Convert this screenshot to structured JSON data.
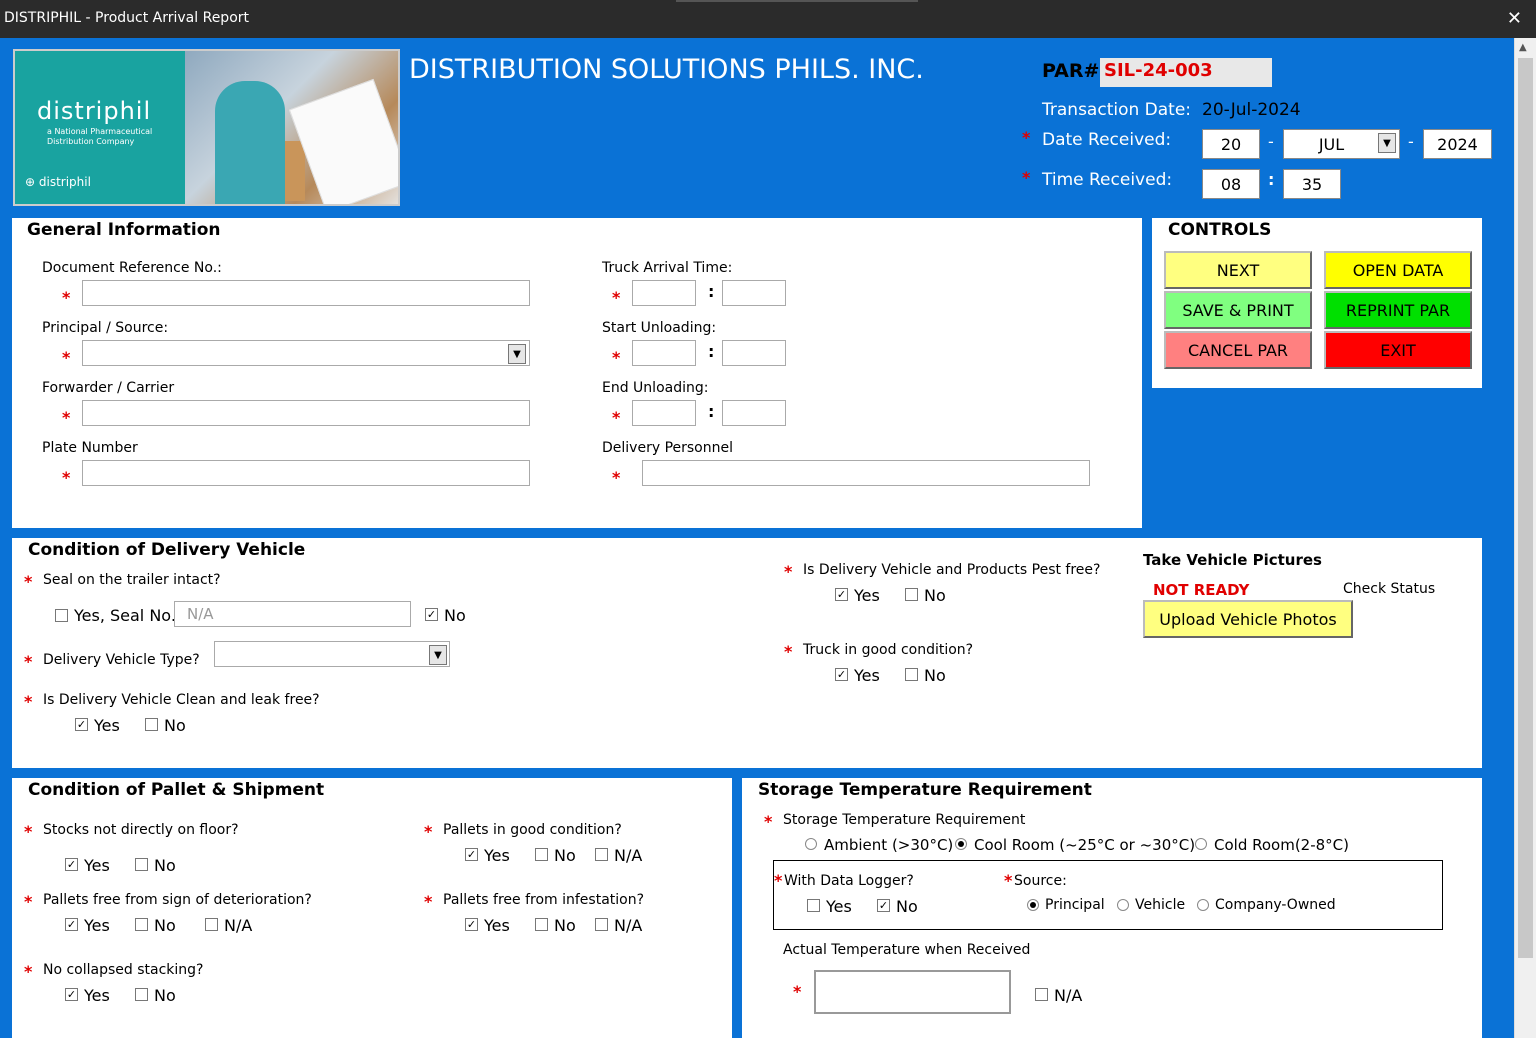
{
  "window": {
    "title": "DISTRIPHIL - Product Arrival Report",
    "close": "✕"
  },
  "logo": {
    "brand": "distriphil",
    "tagline": "a National Pharmaceutical Distribution Company",
    "mini": "distriphil"
  },
  "header": {
    "company": "DISTRIBUTION SOLUTIONS PHILS. INC.",
    "par_label": "PAR#",
    "par_value": "SIL-24-003",
    "transaction_date_label": "Transaction Date:",
    "transaction_date": "20-Jul-2024",
    "date_received_label": "Date Received:",
    "date_day": "20",
    "date_month": "JUL",
    "date_year": "2024",
    "time_received_label": "Time Received:",
    "time_hour": "08",
    "time_min": "35",
    "dash": "-",
    "colon": ":",
    "req": "*"
  },
  "general": {
    "title": "General Information",
    "doc_ref": "Document Reference No.:",
    "principal": "Principal / Source:",
    "forwarder": "Forwarder / Carrier",
    "plate": "Plate Number",
    "truck_arrival": "Truck Arrival Time:",
    "start_unloading": "Start Unloading:",
    "end_unloading": "End Unloading:",
    "personnel": "Delivery Personnel"
  },
  "controls": {
    "title": "CONTROLS",
    "next": "NEXT",
    "open_data": "OPEN DATA",
    "save_print": "SAVE & PRINT",
    "reprint": "REPRINT PAR",
    "cancel": "CANCEL PAR",
    "exit": "EXIT"
  },
  "vehicle": {
    "title": "Condition of Delivery Vehicle",
    "seal_q": "Seal on the trailer intact?",
    "seal_yes": "Yes, Seal No.",
    "seal_placeholder": "N/A",
    "seal_no": "No",
    "type_q": "Delivery Vehicle Type?",
    "clean_q": "Is Delivery Vehicle Clean and leak free?",
    "clean_yes": "Yes",
    "clean_no": "No",
    "pest_q": "Is Delivery Vehicle and Products Pest free?",
    "pest_yes": "Yes",
    "pest_no": "No",
    "truck_q": "Truck in good condition?",
    "truck_yes": "Yes",
    "truck_no": "No",
    "pictures_title": "Take Vehicle Pictures",
    "status": "NOT READY",
    "check_status": "Check Status",
    "upload": "Upload Vehicle Photos"
  },
  "pallet": {
    "title": "Condition of Pallet & Shipment",
    "floor_q": "Stocks not directly on floor?",
    "deterioration_q": "Pallets free from sign of deterioration?",
    "stacking_q": "No collapsed stacking?",
    "good_q": "Pallets in good condition?",
    "infest_q": "Pallets free from infestation?",
    "yes": "Yes",
    "no": "No",
    "na": "N/A"
  },
  "storage": {
    "title": "Storage Temperature Requirement",
    "req_label": "Storage Temperature Requirement",
    "ambient": "Ambient (>30°C)",
    "cool": "Cool Room (~25°C or ~30°C)",
    "cold": "Cold Room(2-8°C)",
    "logger_q": "With Data Logger?",
    "logger_yes": "Yes",
    "logger_no": "No",
    "source_q": "Source:",
    "principal": "Principal",
    "vehicle": "Vehicle",
    "company": "Company-Owned",
    "actual_temp": "Actual Temperature when Received",
    "na": "N/A"
  },
  "colors": {
    "bg": "#0a72d6",
    "red": "#e00000",
    "yellow": "#ffff00",
    "green": "#00e000"
  }
}
